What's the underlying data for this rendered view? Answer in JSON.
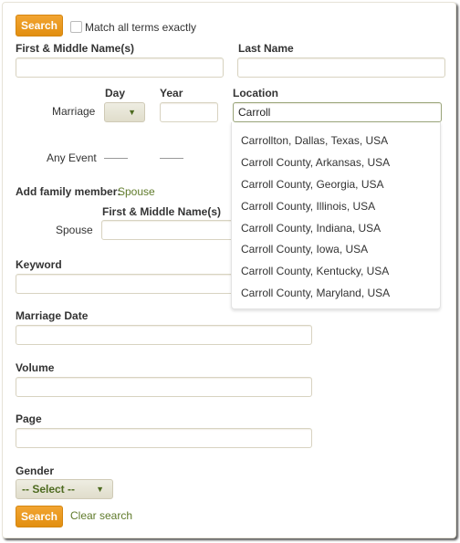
{
  "top": {
    "search_button": "Search",
    "match_exact_label": "Match all terms exactly",
    "match_exact_checked": false
  },
  "name": {
    "first_middle_label": "First & Middle Name(s)",
    "first_middle_value": "",
    "last_label": "Last Name",
    "last_value": ""
  },
  "events": {
    "day_header": "Day",
    "year_header": "Year",
    "location_header": "Location",
    "marriage_label": "Marriage",
    "marriage_day_value": "",
    "marriage_year_value": "",
    "marriage_location_value": "Carroll",
    "any_event_label": "Any Event",
    "location_suggestions": [
      "Carrollton, Dallas, Texas, USA",
      "Carroll County, Arkansas, USA",
      "Carroll County, Georgia, USA",
      "Carroll County, Illinois, USA",
      "Carroll County, Indiana, USA",
      "Carroll County, Iowa, USA",
      "Carroll County, Kentucky, USA",
      "Carroll County, Maryland, USA"
    ]
  },
  "family": {
    "add_label": "Add family member:",
    "spouse_link": "Spouse",
    "spouse_first_middle_label": "First & Middle Name(s)",
    "spouse_row_label": "Spouse",
    "spouse_value": ""
  },
  "fields": {
    "keyword_label": "Keyword",
    "keyword_value": "",
    "marriage_date_label": "Marriage Date",
    "marriage_date_value": "",
    "volume_label": "Volume",
    "volume_value": "",
    "page_label": "Page",
    "page_value": "",
    "gender_label": "Gender",
    "gender_value": "-- Select --"
  },
  "bottom": {
    "search_button": "Search",
    "clear_link": "Clear search"
  },
  "colors": {
    "accent_button": "#eb9b1d",
    "link_green": "#5f7a2a",
    "focus_border": "#9aa57a"
  }
}
